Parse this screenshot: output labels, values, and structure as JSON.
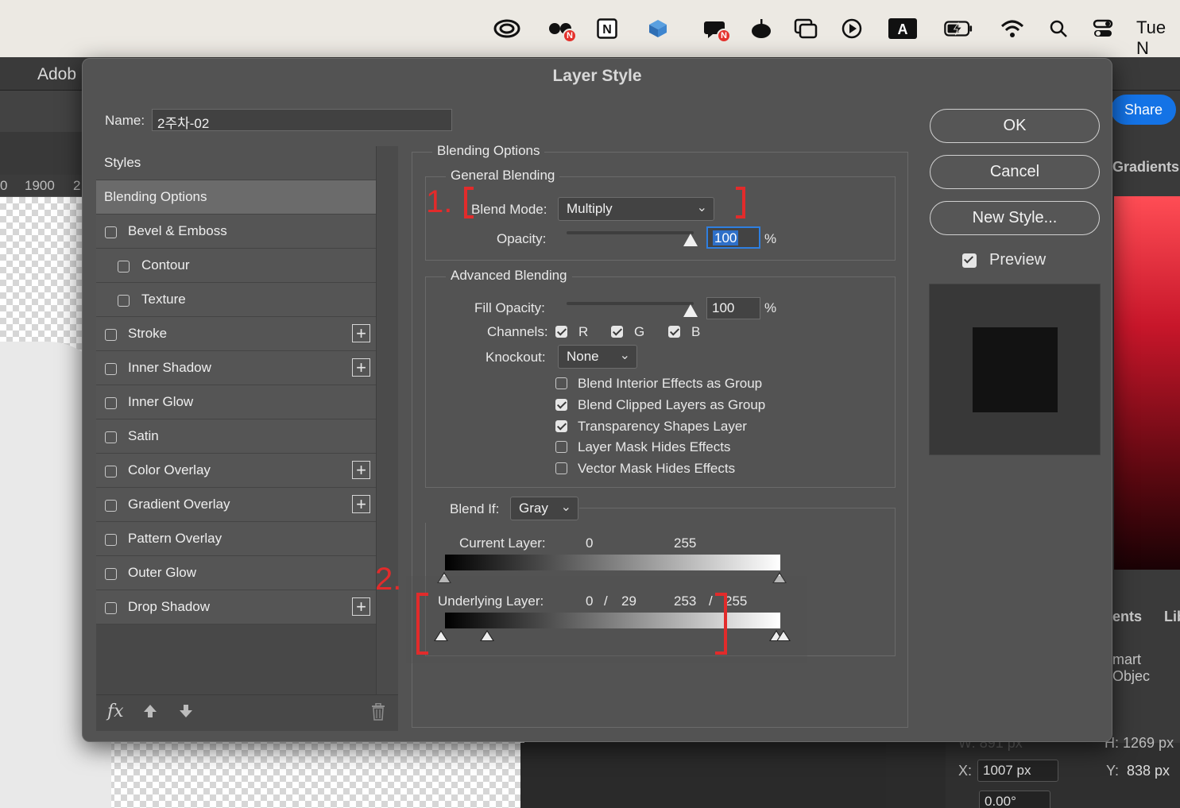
{
  "menubar": {
    "date": "Tue N",
    "icons": [
      "creative-cloud-icon",
      "notification-app-icon",
      "notion-icon",
      "finder-icon",
      "messenger-icon",
      "apple-music-icon",
      "window-stack-icon",
      "play-icon",
      "text-input-icon",
      "battery-icon",
      "wifi-icon",
      "search-icon",
      "control-center-icon"
    ],
    "badge": "N"
  },
  "app": {
    "name": "Adob",
    "share_label": "Share",
    "ruler_labels": [
      "0",
      "1900",
      "2"
    ],
    "panel_tab": "Gradients",
    "panel_tabs2": [
      "ents",
      "Lib"
    ],
    "smart_object": "mart Objec",
    "props": {
      "w_label": "W:",
      "w_value": "891 px",
      "h_label": "H:",
      "h_value": "1269 px",
      "x_label": "X:",
      "x_value": "1007 px",
      "y_label": "Y:",
      "y_value": "838 px",
      "angle_value": "0.00°"
    }
  },
  "dialog": {
    "title": "Layer Style",
    "name_label": "Name:",
    "name_value": "2주차-02",
    "styles": [
      {
        "label": "Styles",
        "type": "header"
      },
      {
        "label": "Blending Options",
        "type": "selected"
      },
      {
        "label": "Bevel & Emboss",
        "checked": false,
        "plus": false
      },
      {
        "label": "Contour",
        "checked": false,
        "plus": false,
        "indent": true
      },
      {
        "label": "Texture",
        "checked": false,
        "plus": false,
        "indent": true
      },
      {
        "label": "Stroke",
        "checked": false,
        "plus": true
      },
      {
        "label": "Inner Shadow",
        "checked": false,
        "plus": true
      },
      {
        "label": "Inner Glow",
        "checked": false,
        "plus": false
      },
      {
        "label": "Satin",
        "checked": false,
        "plus": false
      },
      {
        "label": "Color Overlay",
        "checked": false,
        "plus": true
      },
      {
        "label": "Gradient Overlay",
        "checked": false,
        "plus": true
      },
      {
        "label": "Pattern Overlay",
        "checked": false,
        "plus": false
      },
      {
        "label": "Outer Glow",
        "checked": false,
        "plus": false
      },
      {
        "label": "Drop Shadow",
        "checked": false,
        "plus": true
      }
    ],
    "footer": {
      "fx": "fx"
    },
    "blending": {
      "section_title": "Blending Options",
      "general_title": "General Blending",
      "blend_mode_label": "Blend Mode:",
      "blend_mode_value": "Multiply",
      "opacity_label": "Opacity:",
      "opacity_value": "100",
      "opacity_unit": "%",
      "advanced_title": "Advanced Blending",
      "fill_label": "Fill Opacity:",
      "fill_value": "100",
      "fill_unit": "%",
      "channels_label": "Channels:",
      "channels": [
        {
          "label": "R",
          "checked": true
        },
        {
          "label": "G",
          "checked": true
        },
        {
          "label": "B",
          "checked": true
        }
      ],
      "knockout_label": "Knockout:",
      "knockout_value": "None",
      "options": [
        {
          "label": "Blend Interior Effects as Group",
          "checked": false
        },
        {
          "label": "Blend Clipped Layers as Group",
          "checked": true
        },
        {
          "label": "Transparency Shapes Layer",
          "checked": true
        },
        {
          "label": "Layer Mask Hides Effects",
          "checked": false
        },
        {
          "label": "Vector Mask Hides Effects",
          "checked": false
        }
      ],
      "blend_if_label": "Blend If:",
      "blend_if_value": "Gray",
      "current_layer_label": "Current Layer:",
      "current_low": "0",
      "current_high": "255",
      "underlying_label": "Underlying Layer:",
      "underlying_low_a": "0",
      "underlying_sep1": "/",
      "underlying_low_b": "29",
      "underlying_high_a": "253",
      "underlying_sep2": "/",
      "underlying_high_b": "255"
    },
    "buttons": {
      "ok": "OK",
      "cancel": "Cancel",
      "new_style": "New Style...",
      "preview": "Preview",
      "preview_checked": true
    },
    "annotations": {
      "one": "1.",
      "two": "2."
    }
  },
  "colors": {
    "accent": "#1473e6",
    "annotation": "#e22b2b",
    "dialog_bg": "#535353"
  }
}
